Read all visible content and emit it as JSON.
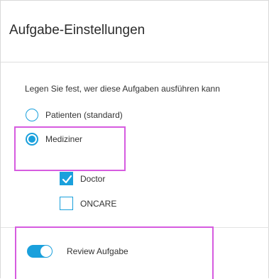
{
  "header": {
    "title": "Aufgabe-Einstellungen"
  },
  "section": {
    "prompt": "Legen Sie fest, wer diese Aufgaben ausführen kann",
    "options": [
      {
        "label": "Patienten (standard)",
        "checked": false
      },
      {
        "label": "Mediziner",
        "checked": true
      }
    ],
    "sub_options": [
      {
        "label": "Doctor",
        "checked": true
      },
      {
        "label": "ONCARE",
        "checked": false
      }
    ]
  },
  "review": {
    "label": "Review Aufgabe",
    "enabled": true
  },
  "colors": {
    "accent": "#1aa0dc",
    "highlight": "#d65ce0"
  }
}
